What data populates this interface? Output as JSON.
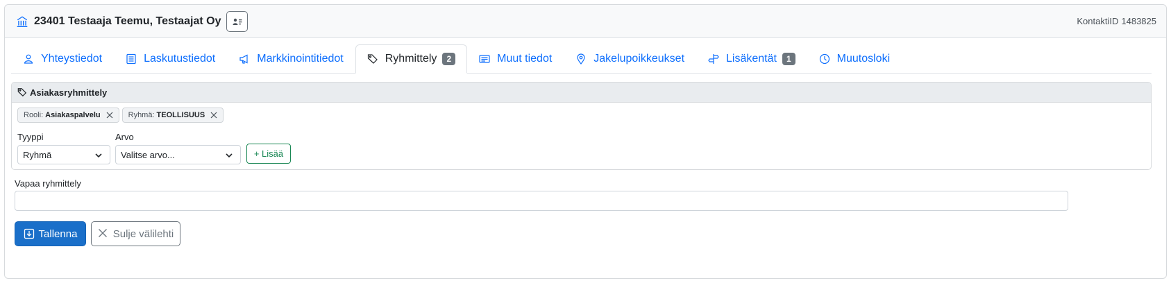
{
  "header": {
    "title": "23401 Testaaja Teemu, Testaajat Oy",
    "contact_id_label": "KontaktiID",
    "contact_id_value": "1483825",
    "icons": {
      "title": "building-icon",
      "contact_card": "contact-card-icon"
    }
  },
  "tabs": [
    {
      "label": "Yhteystiedot",
      "icon": "person-icon",
      "active": false,
      "badge": ""
    },
    {
      "label": "Laskutustiedot",
      "icon": "invoice-icon",
      "active": false,
      "badge": ""
    },
    {
      "label": "Markkinointitiedot",
      "icon": "megaphone-icon",
      "active": false,
      "badge": ""
    },
    {
      "label": "Ryhmittely",
      "icon": "tags-icon",
      "active": true,
      "badge": "2"
    },
    {
      "label": "Muut tiedot",
      "icon": "card-text-icon",
      "active": false,
      "badge": ""
    },
    {
      "label": "Jakelupoikkeukset",
      "icon": "location-pin-icon",
      "active": false,
      "badge": ""
    },
    {
      "label": "Lisäkentät",
      "icon": "signpost-icon",
      "active": false,
      "badge": "1"
    },
    {
      "label": "Muutosloki",
      "icon": "clock-icon",
      "active": false,
      "badge": ""
    }
  ],
  "grouping": {
    "title": "Asiakasryhmittely",
    "chips": [
      {
        "key": "Rooli:",
        "value": "Asiakaspalvelu"
      },
      {
        "key": "Ryhmä:",
        "value": "TEOLLISUUS"
      }
    ],
    "type_label": "Tyyppi",
    "type_value": "Ryhmä",
    "value_label": "Arvo",
    "value_placeholder": "Valitse arvo...",
    "add_label": "+ Lisää"
  },
  "free_grouping": {
    "label": "Vapaa ryhmittely",
    "value": ""
  },
  "actions": {
    "save_label": "Tallenna",
    "close_label": "Sulje välilehti"
  },
  "colors": {
    "link": "#0d6efd",
    "primary": "#1a6fc9",
    "success": "#198754",
    "badge": "#6c757d"
  }
}
